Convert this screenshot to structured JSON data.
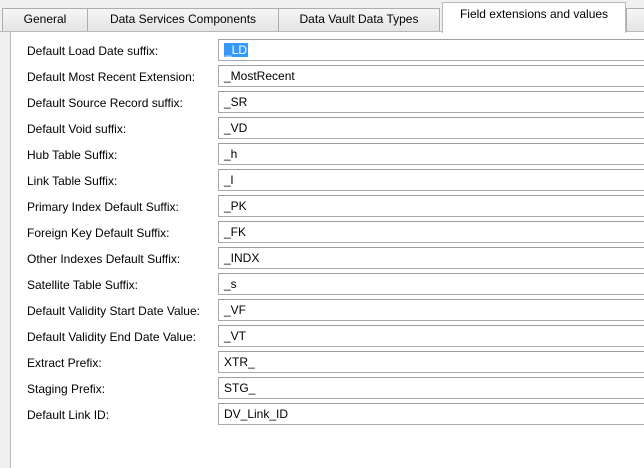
{
  "tabs": [
    {
      "label": "General",
      "active": false
    },
    {
      "label": "Data Services Components",
      "active": false
    },
    {
      "label": "Data Vault Data Types",
      "active": false
    },
    {
      "label": "Field extensions and values",
      "active": true
    }
  ],
  "colors": {
    "selection": "#3399ff",
    "panel_background": "#ffffff",
    "window_background": "#f0f0f0"
  },
  "fields": [
    {
      "label": "Default Load Date suffix:",
      "value": "_LD",
      "selected": true
    },
    {
      "label": "Default Most Recent Extension:",
      "value": "_MostRecent"
    },
    {
      "label": "Default Source Record suffix:",
      "value": "_SR"
    },
    {
      "label": "Default Void suffix:",
      "value": "_VD"
    },
    {
      "label": "Hub Table Suffix:",
      "value": "_h"
    },
    {
      "label": "Link Table Suffix:",
      "value": "_l"
    },
    {
      "label": "Primary Index Default Suffix:",
      "value": "_PK"
    },
    {
      "label": "Foreign Key Default Suffix:",
      "value": "_FK"
    },
    {
      "label": "Other Indexes Default Suffix:",
      "value": "_INDX"
    },
    {
      "label": "Satellite Table Suffix:",
      "value": "_s"
    },
    {
      "label": "Default Validity Start Date Value:",
      "value": "_VF"
    },
    {
      "label": "Default Validity End Date Value:",
      "value": "_VT"
    },
    {
      "label": "Extract Prefix:",
      "value": "XTR_"
    },
    {
      "label": "Staging Prefix:",
      "value": "STG_"
    },
    {
      "label": "Default Link ID:",
      "value": "DV_Link_ID"
    }
  ]
}
